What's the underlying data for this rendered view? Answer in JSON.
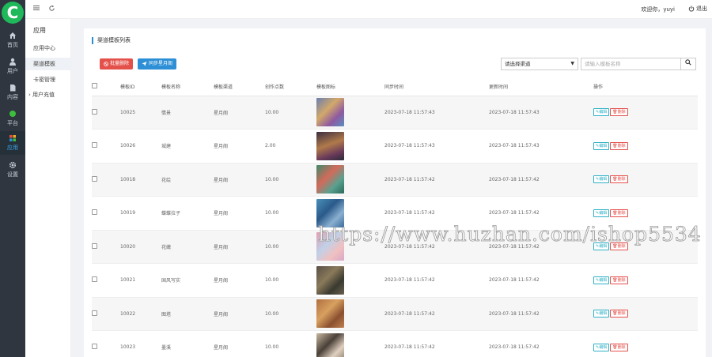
{
  "logo": {
    "letter": "C",
    "color": "#1fb85a"
  },
  "rail": {
    "items": [
      {
        "label": "首页",
        "icon": "home-icon"
      },
      {
        "label": "用户",
        "icon": "user-icon"
      },
      {
        "label": "内容",
        "icon": "document-icon"
      },
      {
        "label": "平台",
        "icon": "circle-icon"
      },
      {
        "label": "应用",
        "icon": "apps-icon",
        "active": true
      },
      {
        "label": "设置",
        "icon": "gear-icon"
      }
    ]
  },
  "submenu": {
    "title": "应用",
    "items": [
      "应用中心",
      "渠道模板",
      "卡密管理",
      "用户充值"
    ],
    "active_index": 1
  },
  "topbar": {
    "menu_icon": "hamburger-icon",
    "refresh_icon": "refresh-icon",
    "welcome": "欢迎你，yuyi",
    "logout": "退出"
  },
  "panel": {
    "title": "渠道模板列表",
    "batch_delete": "批量删除",
    "sync": "同步星月阁",
    "select_placeholder": "请选择渠道",
    "search_placeholder": "请输入模板名称"
  },
  "table": {
    "headers": [
      "模板ID",
      "模板名称",
      "模板渠道",
      "创作点数",
      "模板图标",
      "同步时间",
      "更新时间",
      "操作"
    ],
    "edit_label": "编辑",
    "delete_label": "删除",
    "rows": [
      {
        "id": "10025",
        "name": "情景",
        "channel": "星月阁",
        "points": "10.00",
        "sync": "2023-07-18 11:57:43",
        "update": "2023-07-18 11:57:43"
      },
      {
        "id": "10026",
        "name": "城建",
        "channel": "星月阁",
        "points": "2.00",
        "sync": "2023-07-18 11:57:43",
        "update": "2023-07-18 11:57:43"
      },
      {
        "id": "10018",
        "name": "花绘",
        "channel": "星月阁",
        "points": "10.00",
        "sync": "2023-07-18 11:57:42",
        "update": "2023-07-18 11:57:42"
      },
      {
        "id": "10019",
        "name": "蝶蝶拉子",
        "channel": "星月阁",
        "points": "10.00",
        "sync": "2023-07-18 11:57:42",
        "update": "2023-07-18 11:57:42"
      },
      {
        "id": "10020",
        "name": "花嫩",
        "channel": "星月阁",
        "points": "10.00",
        "sync": "2023-07-18 11:57:42",
        "update": "2023-07-18 11:57:42"
      },
      {
        "id": "10021",
        "name": "国风写实",
        "channel": "星月阁",
        "points": "10.00",
        "sync": "2023-07-18 11:57:42",
        "update": "2023-07-18 11:57:42"
      },
      {
        "id": "10022",
        "name": "图塔",
        "channel": "星月阁",
        "points": "10.00",
        "sync": "2023-07-18 11:57:42",
        "update": "2023-07-18 11:57:42"
      },
      {
        "id": "10023",
        "name": "墨溪",
        "channel": "星月阁",
        "points": "10.00",
        "sync": "2023-07-18 11:57:42",
        "update": "2023-07-18 11:57:42"
      }
    ]
  },
  "watermark": "https://www.huzhan.com/ishop5534"
}
